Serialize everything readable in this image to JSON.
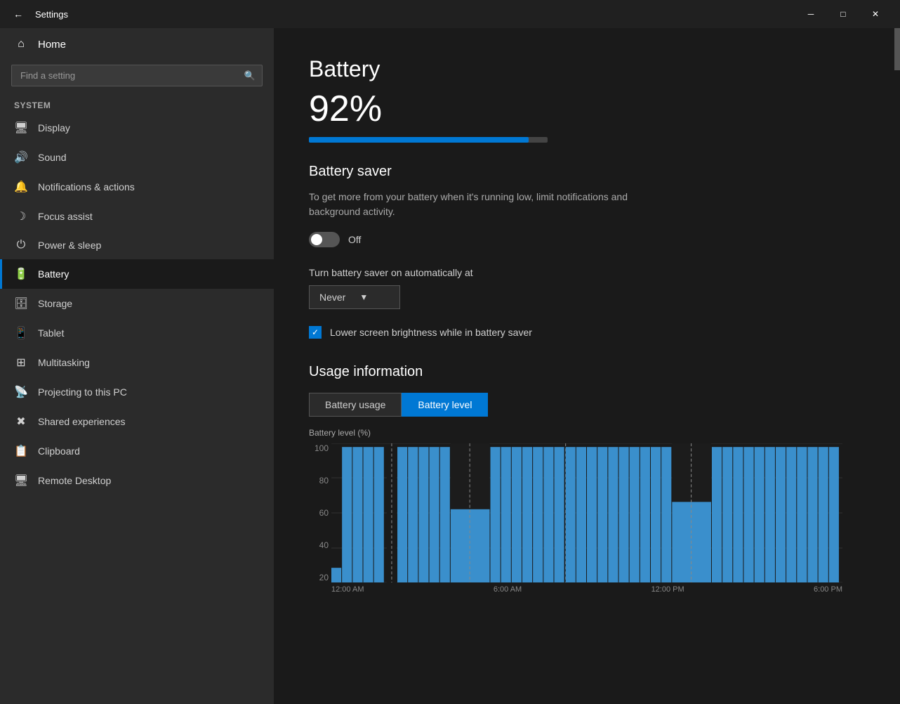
{
  "titleBar": {
    "title": "Settings",
    "backIcon": "←",
    "minimizeIcon": "─",
    "maximizeIcon": "□",
    "closeIcon": "✕"
  },
  "sidebar": {
    "homeLabel": "Home",
    "searchPlaceholder": "Find a setting",
    "sectionLabel": "System",
    "items": [
      {
        "id": "display",
        "icon": "🖥",
        "label": "Display"
      },
      {
        "id": "sound",
        "icon": "🔊",
        "label": "Sound"
      },
      {
        "id": "notifications",
        "icon": "📋",
        "label": "Notifications & actions"
      },
      {
        "id": "focus",
        "icon": "🌙",
        "label": "Focus assist"
      },
      {
        "id": "power",
        "icon": "⏻",
        "label": "Power & sleep"
      },
      {
        "id": "battery",
        "icon": "🔋",
        "label": "Battery",
        "active": true
      },
      {
        "id": "storage",
        "icon": "💾",
        "label": "Storage"
      },
      {
        "id": "tablet",
        "icon": "📱",
        "label": "Tablet"
      },
      {
        "id": "multitasking",
        "icon": "⊞",
        "label": "Multitasking"
      },
      {
        "id": "projecting",
        "icon": "📡",
        "label": "Projecting to this PC"
      },
      {
        "id": "shared",
        "icon": "✖",
        "label": "Shared experiences"
      },
      {
        "id": "clipboard",
        "icon": "📋",
        "label": "Clipboard"
      },
      {
        "id": "remote",
        "icon": "🖥",
        "label": "Remote Desktop"
      }
    ]
  },
  "main": {
    "pageTitle": "Battery",
    "batteryPercent": "92%",
    "batteryBarWidth": "92",
    "batterySaverTitle": "Battery saver",
    "batterySaverDesc": "To get more from your battery when it's running low, limit notifications and background activity.",
    "toggleState": "Off",
    "autoLabel": "Turn battery saver on automatically at",
    "dropdownValue": "Never",
    "checkboxLabel": "Lower screen brightness while in battery saver",
    "usageTitle": "Usage information",
    "chartLabel": "Battery level (%)",
    "tabUsage": "Battery usage",
    "tabLevel": "Battery level",
    "yAxisLabels": [
      "100",
      "80",
      "60",
      "40",
      "20"
    ],
    "xAxisLabels": [
      "12:00 AM",
      "6:00 AM",
      "12:00 PM",
      "6:00 PM"
    ]
  },
  "colors": {
    "accent": "#0078d4",
    "sidebarBg": "#2b2b2b",
    "mainBg": "#1a1a1a",
    "titleBarBg": "#202020"
  }
}
